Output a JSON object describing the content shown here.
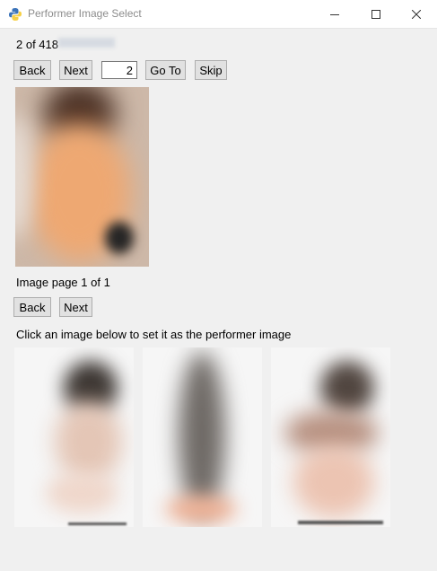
{
  "window": {
    "title": "Performer Image Select"
  },
  "navigation": {
    "counter": "2 of 418",
    "back_label": "Back",
    "next_label": "Next",
    "goto_value": "2",
    "goto_label": "Go To",
    "skip_label": "Skip"
  },
  "image_pager": {
    "label": "Image page 1 of 1",
    "back_label": "Back",
    "next_label": "Next"
  },
  "instruction": "Click an image below to set it as the performer image",
  "thumbnails": [
    "candidate-image-1",
    "candidate-image-2",
    "candidate-image-3"
  ]
}
